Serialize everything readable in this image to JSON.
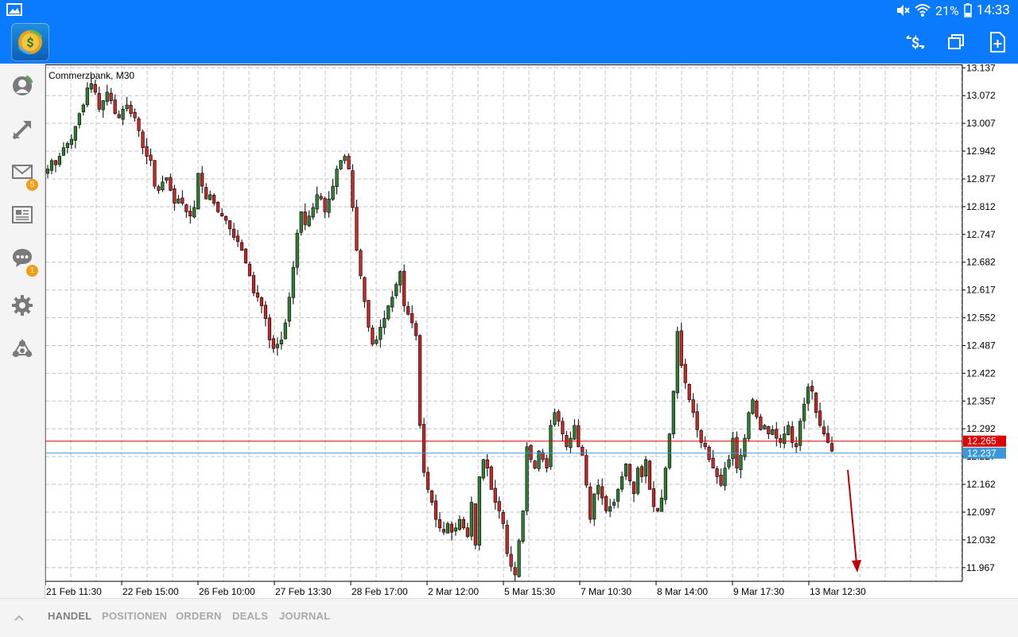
{
  "status_bar": {
    "battery": "21%",
    "time": "14:33"
  },
  "chart": {
    "title": "Commerzbank, M30",
    "y_labels": [
      "13.137",
      "13.072",
      "13.007",
      "12.942",
      "12.877",
      "12.812",
      "12.747",
      "12.682",
      "12.617",
      "12.552",
      "12.487",
      "12.422",
      "12.357",
      "12.292",
      "12.227",
      "12.162",
      "12.097",
      "12.032",
      "11.967"
    ],
    "x_labels": [
      "21 Feb 11:30",
      "22 Feb 15:00",
      "26 Feb 10:00",
      "27 Feb 13:30",
      "28 Feb 17:00",
      "2 Mar 12:00",
      "5 Mar 15:30",
      "7 Mar 10:30",
      "8 Mar 14:00",
      "9 Mar 17:30",
      "13 Mar 12:30"
    ],
    "bid_price": "12.265",
    "ask_price": "12.237",
    "bid_color": "#e00000",
    "ask_color": "#3a9ad9"
  },
  "chart_data": {
    "type": "candlestick",
    "symbol": "Commerzbank",
    "timeframe": "M30",
    "ylim": [
      11.935,
      13.145
    ],
    "closes": [
      12.9,
      12.92,
      12.91,
      12.93,
      12.95,
      12.96,
      12.97,
      13.0,
      13.03,
      13.05,
      13.09,
      13.1,
      13.08,
      13.04,
      13.06,
      13.08,
      13.06,
      13.03,
      13.02,
      13.04,
      13.05,
      13.03,
      13.02,
      12.99,
      12.95,
      12.93,
      12.92,
      12.86,
      12.85,
      12.87,
      12.88,
      12.85,
      12.82,
      12.83,
      12.82,
      12.8,
      12.79,
      12.81,
      12.89,
      12.86,
      12.83,
      12.84,
      12.82,
      12.8,
      12.79,
      12.78,
      12.76,
      12.74,
      12.73,
      12.71,
      12.68,
      12.65,
      12.61,
      12.6,
      12.58,
      12.55,
      12.5,
      12.48,
      12.49,
      12.5,
      12.54,
      12.6,
      12.67,
      12.75,
      12.8,
      12.77,
      12.79,
      12.81,
      12.84,
      12.83,
      12.8,
      12.83,
      12.86,
      12.9,
      12.92,
      12.93,
      12.9,
      12.81,
      12.71,
      12.65,
      12.59,
      12.53,
      12.49,
      12.5,
      12.53,
      12.55,
      12.58,
      12.6,
      12.63,
      12.66,
      12.58,
      12.56,
      12.54,
      12.51,
      12.3,
      12.19,
      12.15,
      12.12,
      12.08,
      12.06,
      12.05,
      12.07,
      12.05,
      12.06,
      12.08,
      12.06,
      12.04,
      12.12,
      12.02,
      12.18,
      12.22,
      12.2,
      12.15,
      12.12,
      12.1,
      12.07,
      12.0,
      11.97,
      11.95,
      12.03,
      12.1,
      12.25,
      12.22,
      12.2,
      12.24,
      12.22,
      12.2,
      12.3,
      12.33,
      12.31,
      12.28,
      12.25,
      12.27,
      12.3,
      12.25,
      12.23,
      12.16,
      12.08,
      12.14,
      12.16,
      12.13,
      12.1,
      12.11,
      12.12,
      12.15,
      12.18,
      12.21,
      12.17,
      12.14,
      12.2,
      12.18,
      12.22,
      12.15,
      12.11,
      12.1,
      12.13,
      12.2,
      12.28,
      12.38,
      12.52,
      12.44,
      12.4,
      12.36,
      12.33,
      12.29,
      12.26,
      12.25,
      12.22,
      12.2,
      12.18,
      12.16,
      12.2,
      12.22,
      12.27,
      12.2,
      12.23,
      12.27,
      12.33,
      12.36,
      12.32,
      12.29,
      12.3,
      12.28,
      12.29,
      12.27,
      12.26,
      12.28,
      12.3,
      12.26,
      12.25,
      12.31,
      12.35,
      12.39,
      12.38,
      12.33,
      12.3,
      12.28,
      12.26,
      12.24
    ]
  },
  "bottom_tabs": [
    "HANDEL",
    "POSITIONEN",
    "ORDERN",
    "DEALS",
    "JOURNAL"
  ],
  "badges": {
    "mail": "5",
    "chat": "1"
  }
}
